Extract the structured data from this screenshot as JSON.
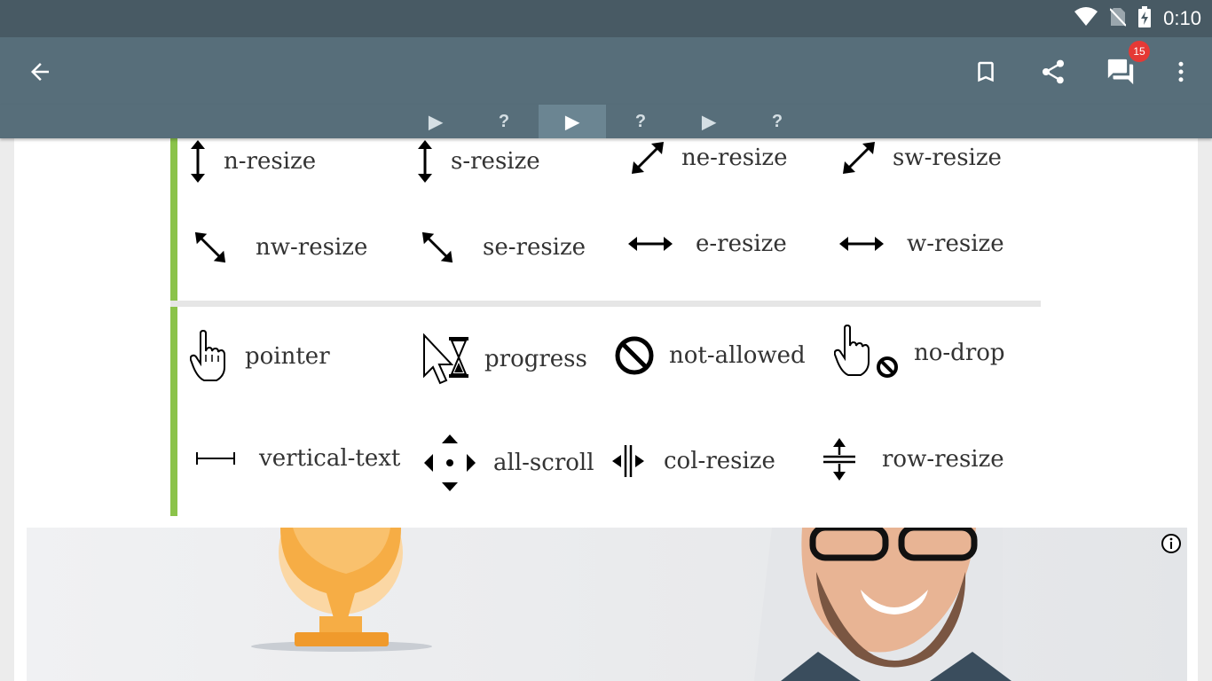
{
  "status_bar": {
    "time": "0:10",
    "icons": [
      "wifi-icon",
      "no-sim-icon",
      "battery-charging-icon"
    ]
  },
  "app_bar": {
    "back_icon": "arrow-left-icon",
    "actions": [
      "bookmark-icon",
      "share-icon",
      "comments-icon",
      "more-vert-icon"
    ],
    "comments_badge": "15"
  },
  "tabs": [
    {
      "label": "▶",
      "icon": "play-icon",
      "active": false
    },
    {
      "label": "?",
      "icon": "",
      "active": false
    },
    {
      "label": "▶",
      "icon": "play-icon",
      "active": true
    },
    {
      "label": "?",
      "icon": "",
      "active": false
    },
    {
      "label": "▶",
      "icon": "play-icon",
      "active": false
    },
    {
      "label": "?",
      "icon": "",
      "active": false
    }
  ],
  "cursor_panel_a": {
    "row1": [
      "n-resize",
      "s-resize",
      "ne-resize",
      "sw-resize"
    ],
    "row2": [
      "nw-resize",
      "se-resize",
      "e-resize",
      "w-resize"
    ]
  },
  "cursor_panel_b": {
    "row1": [
      "pointer",
      "progress",
      "not-allowed",
      "no-drop"
    ],
    "row2": [
      "vertical-text",
      "all-scroll",
      "col-resize",
      "row-resize"
    ]
  },
  "colors": {
    "status_bar": "#485a64",
    "app_bar": "#576e7a",
    "accent_border": "#8bc34a",
    "badge": "#e53935"
  },
  "ad": {
    "info_icon": "info-icon"
  }
}
